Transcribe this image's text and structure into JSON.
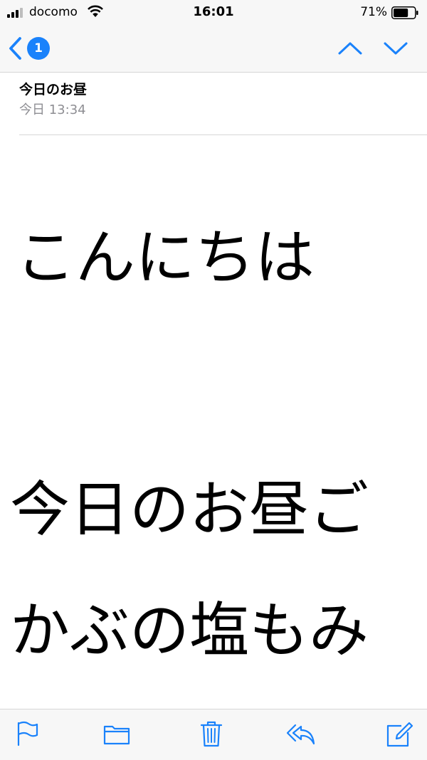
{
  "status_bar": {
    "carrier": "docomo",
    "time": "16:01",
    "battery_percent": "71%",
    "battery_level": 0.71,
    "icons": [
      "signal-icon",
      "wifi-icon",
      "battery-icon"
    ]
  },
  "nav": {
    "unread_count": "1",
    "icons": [
      "back-chevron-icon",
      "previous-message-icon",
      "next-message-icon"
    ]
  },
  "message": {
    "subject": "今日のお昼",
    "date": "今日 13:34",
    "body_lines": [
      "こんにちは",
      "今日のお昼ご",
      "かぶの塩もみ"
    ]
  },
  "toolbar": {
    "icons": [
      "flag-icon",
      "folder-icon",
      "trash-icon",
      "reply-icon",
      "compose-icon"
    ]
  },
  "colors": {
    "accent": "#1a82fb",
    "secondary_text": "#8e8e93",
    "bar_background": "#f7f7f7"
  }
}
